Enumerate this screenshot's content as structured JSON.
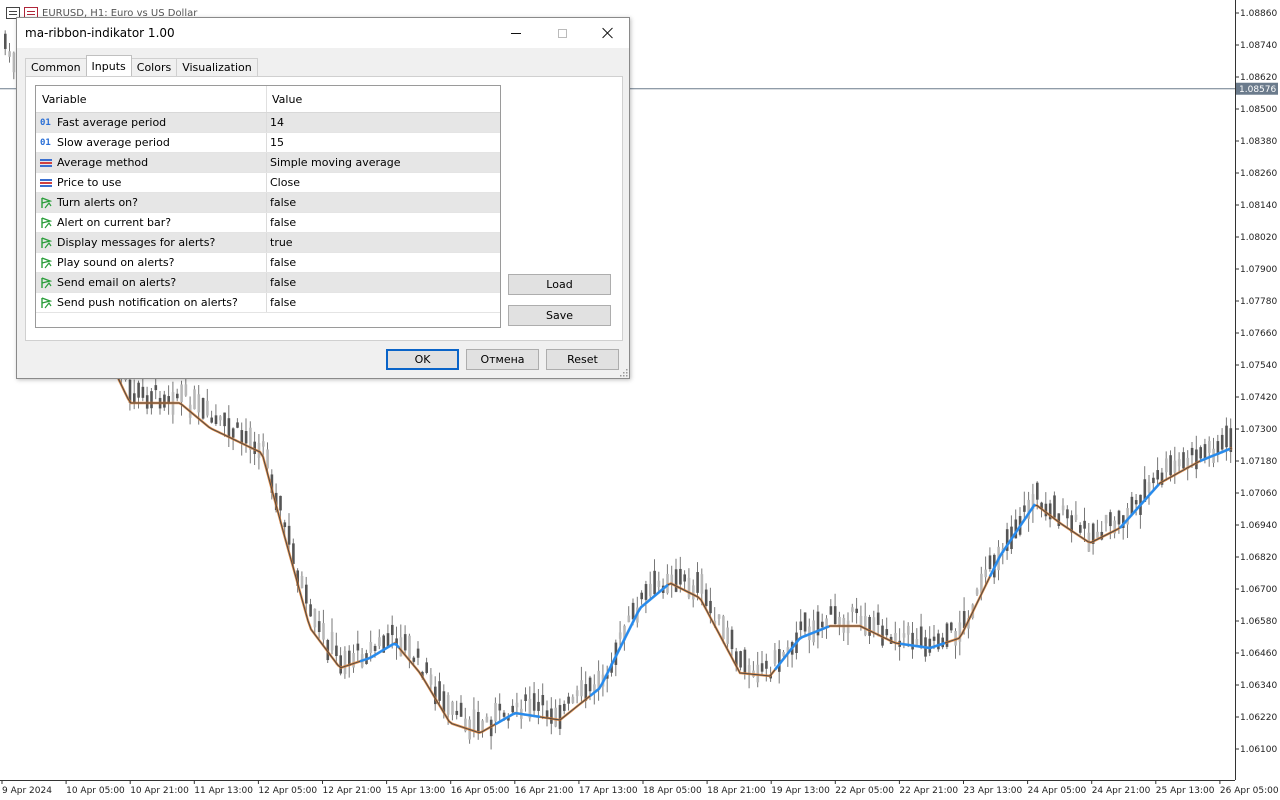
{
  "chart": {
    "header_text": "EURUSD, H1:  Euro vs US Dollar",
    "current_price": "1.08576",
    "price_labels": [
      "1.08860",
      "1.08740",
      "1.08620",
      "1.08500",
      "1.08380",
      "1.08260",
      "1.08140",
      "1.08020",
      "1.07900",
      "1.07780",
      "1.07660",
      "1.07540",
      "1.07420",
      "1.07300",
      "1.07180",
      "1.07060",
      "1.06940",
      "1.06820",
      "1.06700",
      "1.06580",
      "1.06460",
      "1.06340",
      "1.06220",
      "1.06100"
    ],
    "time_labels": [
      "9 Apr 2024",
      "10 Apr 05:00",
      "10 Apr 21:00",
      "11 Apr 13:00",
      "12 Apr 05:00",
      "12 Apr 21:00",
      "15 Apr 13:00",
      "16 Apr 05:00",
      "16 Apr 21:00",
      "17 Apr 13:00",
      "18 Apr 05:00",
      "18 Apr 21:00",
      "19 Apr 13:00",
      "22 Apr 05:00",
      "22 Apr 21:00",
      "23 Apr 13:00",
      "24 Apr 05:00",
      "24 Apr 21:00",
      "25 Apr 13:00",
      "26 Apr 05:00"
    ],
    "colors": {
      "bull_ribbon": "#1e90ff",
      "bear_ribbon": "#e07b2a",
      "candle": "#555555",
      "price_tag": "#6b7b8c"
    }
  },
  "dialog": {
    "title": "ma-ribbon-indikator 1.00",
    "tabs": [
      {
        "label": "Common"
      },
      {
        "label": "Inputs"
      },
      {
        "label": "Colors"
      },
      {
        "label": "Visualization"
      }
    ],
    "grid": {
      "col_variable": "Variable",
      "col_value": "Value",
      "rows": [
        {
          "icon": "integer-icon",
          "icon_text": "01",
          "variable": "Fast average period",
          "value": "14"
        },
        {
          "icon": "integer-icon",
          "icon_text": "01",
          "variable": "Slow average period",
          "value": "15"
        },
        {
          "icon": "enum-icon",
          "variable": "Average method",
          "value": "Simple moving average"
        },
        {
          "icon": "enum-icon",
          "variable": "Price to use",
          "value": "Close"
        },
        {
          "icon": "bool-icon",
          "variable": "Turn alerts on?",
          "value": "false"
        },
        {
          "icon": "bool-icon",
          "variable": "Alert on current bar?",
          "value": "false"
        },
        {
          "icon": "bool-icon",
          "variable": "Display messages for alerts?",
          "value": "true"
        },
        {
          "icon": "bool-icon",
          "variable": "Play sound on alerts?",
          "value": "false"
        },
        {
          "icon": "bool-icon",
          "variable": "Send email on alerts?",
          "value": "false"
        },
        {
          "icon": "bool-icon",
          "variable": "Send push notification on alerts?",
          "value": "false"
        }
      ]
    },
    "buttons": {
      "load": "Load",
      "save": "Save",
      "ok": "OK",
      "cancel": "Отмена",
      "reset": "Reset"
    }
  }
}
